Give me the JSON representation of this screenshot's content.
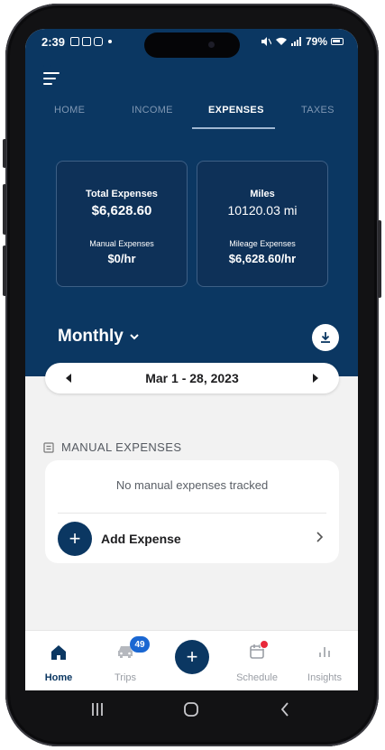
{
  "status_bar": {
    "time": "2:39",
    "battery": "79%"
  },
  "tabs": [
    "HOME",
    "INCOME",
    "EXPENSES",
    "TAXES"
  ],
  "active_tab": "EXPENSES",
  "cards": {
    "expenses": {
      "label": "Total Expenses",
      "value": "$6,628.60",
      "sub_label": "Manual Expenses",
      "sub_value": "$0/hr"
    },
    "miles": {
      "label": "Miles",
      "value": "10120.03 mi",
      "sub_label": "Mileage Expenses",
      "sub_value": "$6,628.60/hr"
    }
  },
  "period": {
    "selector_label": "Monthly",
    "date_range": "Mar 1 - 28, 2023"
  },
  "manual_expenses": {
    "title": "MANUAL EXPENSES",
    "empty_message": "No manual expenses tracked",
    "add_label": "Add Expense"
  },
  "bottom_nav": {
    "items": [
      "Home",
      "Trips",
      "Schedule",
      "Insights"
    ],
    "trips_badge": "49",
    "active": "Home"
  },
  "colors": {
    "header_bg": "#0b3762",
    "accent": "#0b3762",
    "badge_blue": "#1a67d2",
    "badge_red": "#e8283a"
  },
  "icons": [
    "menu-icon",
    "download-icon",
    "chevron-left-icon",
    "chevron-right-icon",
    "chevron-down-icon",
    "receipt-icon",
    "plus-icon",
    "home-icon",
    "car-icon",
    "calendar-icon",
    "bar-chart-icon"
  ]
}
